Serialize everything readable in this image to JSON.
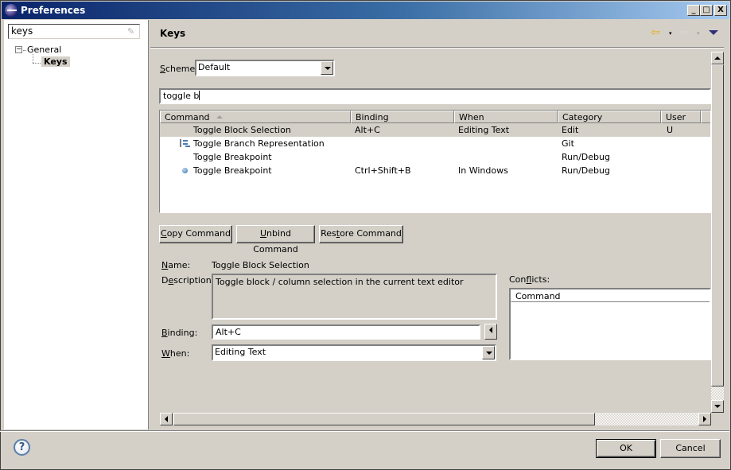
{
  "window": {
    "title": "Preferences",
    "controls": {
      "minimize": "_",
      "maximize": "□",
      "close": "X"
    }
  },
  "sidebar": {
    "filter_value": "keys",
    "tree": [
      {
        "label": "General",
        "expanded": true,
        "toggle": "−"
      },
      {
        "label": "Keys",
        "selected": true
      }
    ]
  },
  "page": {
    "title": "Keys",
    "nav": {
      "back": "⇦",
      "forward": "⇨",
      "dropdown": "▾"
    },
    "scheme_label": "Scheme:",
    "scheme_mnemonic": "S",
    "scheme_rest": "cheme:",
    "scheme_value": "Default",
    "filter_value": "toggle b",
    "table": {
      "columns": [
        "Command",
        "Binding",
        "When",
        "Category",
        "User"
      ],
      "rows": [
        {
          "command": "Toggle Block Selection",
          "binding": "Alt+C",
          "when": "Editing Text",
          "category": "Edit",
          "user": "U",
          "icon": "",
          "selected": true
        },
        {
          "command": "Toggle Branch Representation",
          "binding": "",
          "when": "",
          "category": "Git",
          "user": "",
          "icon": "branch-representation-icon"
        },
        {
          "command": "Toggle Breakpoint",
          "binding": "",
          "when": "",
          "category": "Run/Debug",
          "user": "",
          "icon": ""
        },
        {
          "command": "Toggle Breakpoint",
          "binding": "Ctrl+Shift+B",
          "when": "In Windows",
          "category": "Run/Debug",
          "user": "",
          "icon": "breakpoint-icon"
        }
      ]
    },
    "buttons": {
      "copy": {
        "m": "C",
        "rest": "opy Command"
      },
      "unbind": {
        "m": "U",
        "rest": "nbind Command"
      },
      "restore": {
        "pre": "Res",
        "m": "t",
        "rest": "ore Command"
      }
    },
    "details": {
      "name_label": {
        "m": "N",
        "rest": "ame:"
      },
      "name_value": "Toggle Block Selection",
      "description_label": {
        "pre": "D",
        "m": "e",
        "rest": "scription:"
      },
      "description_value": "Toggle block / column selection in the current text editor",
      "binding_label": {
        "m": "B",
        "rest": "inding:"
      },
      "binding_value": "Alt+C",
      "when_label": {
        "m": "W",
        "rest": "hen:"
      },
      "when_value": "Editing Text"
    },
    "conflicts": {
      "label": {
        "pre": "Con",
        "m": "f",
        "rest": "licts:"
      },
      "columns": [
        "Command"
      ]
    }
  },
  "footer": {
    "help": "?",
    "ok": "OK",
    "cancel": "Cancel"
  }
}
